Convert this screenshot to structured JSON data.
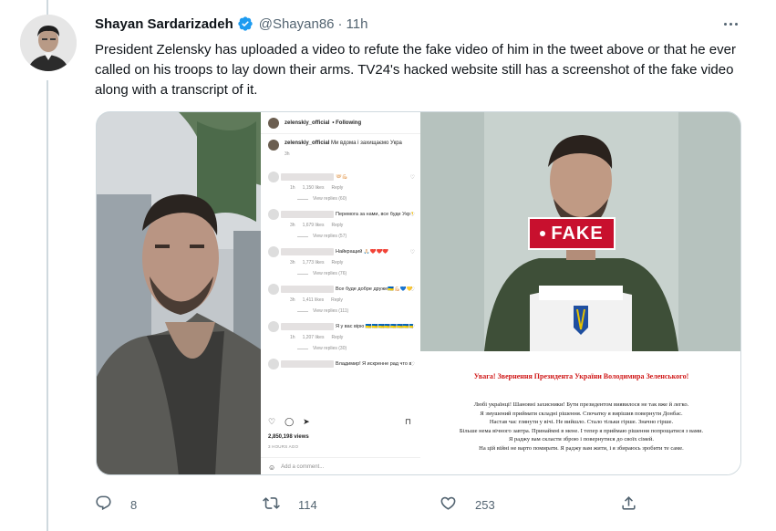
{
  "tweet": {
    "display_name": "Shayan Sardarizadeh",
    "handle": "@Shayan86",
    "separator": "·",
    "time": "11h",
    "text": "President Zelensky has uploaded a video to refute the fake video of him in the tweet above or that he ever called on his troops to lay down their arms. TV24's hacked website still has a screenshot of the fake video along with a transcript of it."
  },
  "instagram": {
    "username": "zelenskiy_official",
    "follow_label": "• Following",
    "caption_user": "zelenskiy_official",
    "caption_text": "Ми вдома і захищаємо Укра",
    "caption_time": "3h",
    "comments": [
      {
        "text": "🤝🏻💪🏻",
        "age": "1h",
        "likes": "1,150 likes",
        "reply": "Reply",
        "replies": "View replies (60)"
      },
      {
        "text": "Перемога за нами, все буде Укр 💛",
        "age": "3h",
        "likes": "1,679 likes",
        "reply": "Reply",
        "replies": "View replies (57)"
      },
      {
        "text": "Найкращий 🙏🏻❤️❤️❤️",
        "age": "3h",
        "likes": "1,773 likes",
        "reply": "Reply",
        "replies": "View replies (76)"
      },
      {
        "text": "Все буде добре друже🇺🇦💪🏻💙💛",
        "age": "3h",
        "likes": "1,411 likes",
        "reply": "Reply",
        "replies": "View replies (111)"
      },
      {
        "text": "Я у вас вірю 🇺🇦🇺🇦🇺🇦🇺🇦🇺🇦🇺🇦🇺🇦🇺🇦🇺🇦",
        "age": "1h",
        "likes": "1,207 likes",
        "reply": "Reply",
        "replies": "View replies (30)"
      },
      {
        "text": "Владимир! Я искренне рад что в",
        "age": "",
        "likes": "",
        "reply": "",
        "replies": ""
      }
    ],
    "views": "2,850,198 views",
    "time_ago": "3 HOURS AGO",
    "add_comment": "Add a comment..."
  },
  "fake_panel": {
    "badge": "FAKE",
    "heading": "Увага! Звернення Президента України Володимира Зеленського!",
    "transcript": [
      "Любі українці! Шановні захисники! Бути президентом виявилося не так вже й легко.",
      "Я змушений приймати складні рішення. Спочатку я вирішив повернути Донбас.",
      "Настав час глянути у вічі. Не вийшло. Стало тільки гірше. Значно гірше.",
      "Більше нема вічного завтра. Принаймні в мене. І тепер я приймаю рішення попрощатися з вами.",
      "Я раджу вам скласти зброю і повернутися до своїх сімей.",
      "На цій війні не варто помирати. Я раджу вам жити, і я збираюсь зробити те саме."
    ]
  },
  "actions": {
    "reply_count": "8",
    "retweet_count": "114",
    "like_count": "253"
  },
  "icons": {
    "verified": "verified-badge-icon",
    "reply": "reply-icon",
    "retweet": "retweet-icon",
    "like": "heart-icon",
    "share": "share-icon",
    "more": "more-icon"
  },
  "colors": {
    "verified": "#1d9bf0",
    "muted": "#536471",
    "fake_red": "#c8102e",
    "heading_red": "#d01818"
  }
}
